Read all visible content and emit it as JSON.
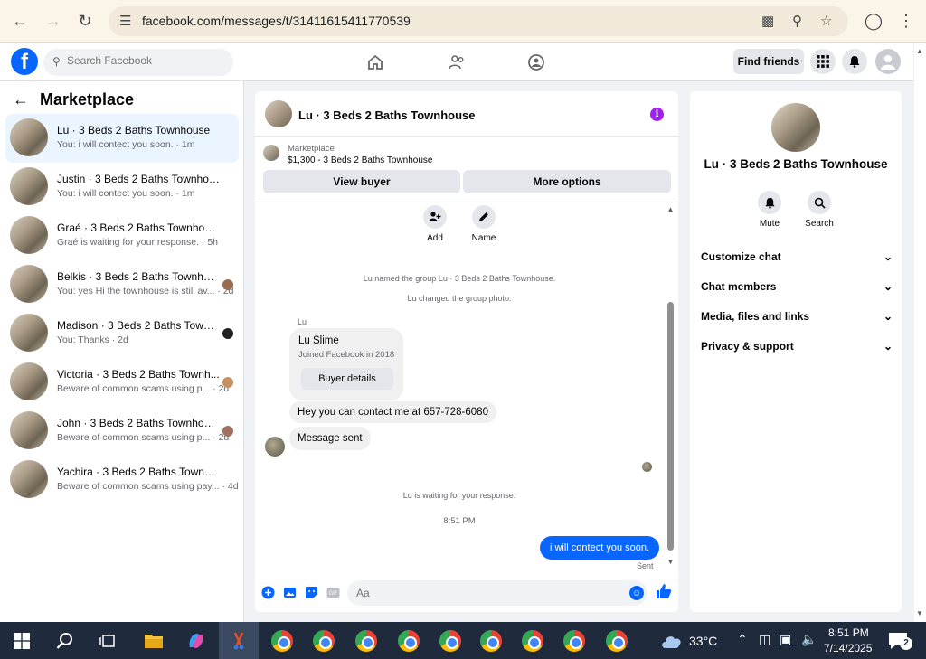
{
  "browser": {
    "url": "facebook.com/messages/t/31411615411770539",
    "icons": [
      "back-arrow-icon",
      "forward-arrow-icon",
      "reload-icon",
      "site-info-icon",
      "install-app-icon",
      "zoom-icon",
      "bookmark-star-icon",
      "profile-icon",
      "menu-dots-icon"
    ]
  },
  "fb": {
    "search_placeholder": "Search Facebook",
    "find_friends": "Find friends",
    "brand_color": "#0866ff"
  },
  "sidebar": {
    "title": "Marketplace",
    "conversations": [
      {
        "name": "Lu · 3 Beds 2 Baths Townhouse",
        "preview": "You: i will contect you soon. · 1m",
        "active": true
      },
      {
        "name": "Justin · 3 Beds 2 Baths Townhouse",
        "preview": "You: i will contect you soon. · 1m"
      },
      {
        "name": "Graé · 3 Beds 2 Baths Townhouse",
        "preview": "Graé is waiting for your response. · 5h"
      },
      {
        "name": "Belkis · 3 Beds 2 Baths Townhouse",
        "preview": "You: yes Hi the townhouse is still av... · 2d"
      },
      {
        "name": "Madison · 3 Beds 2 Baths Townh...",
        "preview": "You: Thanks · 2d"
      },
      {
        "name": "Victoria · 3 Beds 2 Baths Townh...",
        "preview": "Beware of common scams using p... · 2d"
      },
      {
        "name": "John · 3 Beds 2 Baths Townhouse",
        "preview": "Beware of common scams using p... · 2d"
      },
      {
        "name": "Yachira · 3 Beds 2 Baths Townhouse",
        "preview": "Beware of common scams using pay... · 4d"
      }
    ]
  },
  "chat": {
    "title": "Lu · 3 Beds 2 Baths Townhouse",
    "marketplace_label": "Marketplace",
    "listing": "$1,300 - 3 Beds 2 Baths Townhouse",
    "view_buyer": "View buyer",
    "more_options": "More options",
    "add_label": "Add",
    "name_label": "Name",
    "sys1": "Lu named the group Lu · 3 Beds 2 Baths Townhouse.",
    "sys2": "Lu changed the group photo.",
    "sender": "Lu",
    "profile_name": "Lu Slime",
    "profile_joined": "Joined Facebook in 2018",
    "buyer_details": "Buyer details",
    "msg1": "Hey you can contact me at 657-728-6080",
    "msg2": "Message sent",
    "waiting": "Lu is waiting for your response.",
    "time": "8:51 PM",
    "sent_msg": "i will contect you soon.",
    "sent_status": "Sent",
    "composer_placeholder": "Aa"
  },
  "info_panel": {
    "title": "Lu · 3 Beds 2 Baths Townhouse",
    "mute": "Mute",
    "search": "Search",
    "sections": [
      "Customize chat",
      "Chat members",
      "Media, files and links",
      "Privacy & support"
    ]
  },
  "taskbar": {
    "weather": "33°C",
    "time": "8:51 PM",
    "date": "7/14/2025",
    "notifications": "2"
  }
}
